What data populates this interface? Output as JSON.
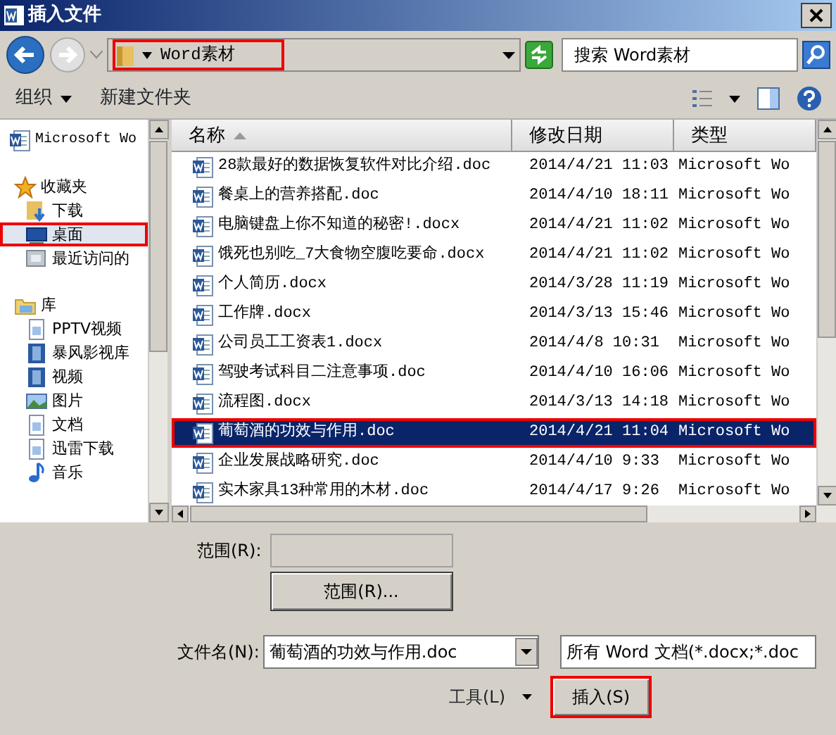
{
  "window": {
    "title": "插入文件"
  },
  "address": {
    "path": "Word素材",
    "highlighted": true
  },
  "search": {
    "placeholder": "搜索 Word素材"
  },
  "toolbar": [
    {
      "label": "组织",
      "menu": true
    },
    {
      "label": "新建文件夹",
      "menu": false
    }
  ],
  "sidebar": {
    "items": [
      {
        "label": "Microsoft Wo",
        "kind": "word",
        "selected": false,
        "highlighted": false
      },
      {
        "label": "收藏夹",
        "kind": "star",
        "selected": false,
        "highlighted": false,
        "children": [
          {
            "label": "下载",
            "kind": "download",
            "selected": false,
            "highlighted": false
          },
          {
            "label": "桌面",
            "kind": "desktop",
            "selected": true,
            "highlighted": true
          },
          {
            "label": "最近访问的",
            "kind": "recent",
            "selected": false,
            "highlighted": false
          }
        ]
      },
      {
        "label": "库",
        "kind": "library",
        "selected": false,
        "highlighted": false,
        "children": [
          {
            "label": "PPTV视频",
            "kind": "doc",
            "selected": false,
            "highlighted": false
          },
          {
            "label": "暴风影视库",
            "kind": "film",
            "selected": false,
            "highlighted": false
          },
          {
            "label": "视频",
            "kind": "film",
            "selected": false,
            "highlighted": false
          },
          {
            "label": "图片",
            "kind": "image",
            "selected": false,
            "highlighted": false
          },
          {
            "label": "文档",
            "kind": "doc",
            "selected": false,
            "highlighted": false
          },
          {
            "label": "迅雷下载",
            "kind": "doc",
            "selected": false,
            "highlighted": false
          },
          {
            "label": "音乐",
            "kind": "music",
            "selected": false,
            "highlighted": false
          }
        ]
      }
    ]
  },
  "table": {
    "columns": [
      {
        "label": "名称",
        "sorted": true
      },
      {
        "label": "修改日期",
        "sorted": false
      },
      {
        "label": "类型",
        "sorted": false
      }
    ],
    "rows": [
      {
        "name": "28款最好的数据恢复软件对比介绍.doc",
        "date": "2014/4/21 11:03",
        "type": "Microsoft Wo",
        "selected": false,
        "highlighted": false
      },
      {
        "name": "餐桌上的营养搭配.doc",
        "date": "2014/4/10 18:11",
        "type": "Microsoft Wo",
        "selected": false,
        "highlighted": false
      },
      {
        "name": "电脑键盘上你不知道的秘密!.docx",
        "date": "2014/4/21 11:02",
        "type": "Microsoft Wo",
        "selected": false,
        "highlighted": false
      },
      {
        "name": "饿死也别吃_7大食物空腹吃要命.docx",
        "date": "2014/4/21 11:02",
        "type": "Microsoft Wo",
        "selected": false,
        "highlighted": false
      },
      {
        "name": "个人简历.docx",
        "date": "2014/3/28 11:19",
        "type": "Microsoft Wo",
        "selected": false,
        "highlighted": false
      },
      {
        "name": "工作牌.docx",
        "date": "2014/3/13 15:46",
        "type": "Microsoft Wo",
        "selected": false,
        "highlighted": false
      },
      {
        "name": "公司员工工资表1.docx",
        "date": "2014/4/8 10:31",
        "type": "Microsoft Wo",
        "selected": false,
        "highlighted": false
      },
      {
        "name": "驾驶考试科目二注意事项.doc",
        "date": "2014/4/10 16:06",
        "type": "Microsoft Wo",
        "selected": false,
        "highlighted": false
      },
      {
        "name": "流程图.docx",
        "date": "2014/3/13 14:18",
        "type": "Microsoft Wo",
        "selected": false,
        "highlighted": false
      },
      {
        "name": "葡萄酒的功效与作用.doc",
        "date": "2014/4/21 11:04",
        "type": "Microsoft Wo",
        "selected": true,
        "highlighted": true
      },
      {
        "name": "企业发展战略研究.doc",
        "date": "2014/4/10 9:33",
        "type": "Microsoft Wo",
        "selected": false,
        "highlighted": false
      },
      {
        "name": "实木家具13种常用的木材.doc",
        "date": "2014/4/17 9:26",
        "type": "Microsoft Wo",
        "selected": false,
        "highlighted": false
      }
    ]
  },
  "range": {
    "label": "范围(R):",
    "disabled": true,
    "button": "范围(R)..."
  },
  "filename": {
    "label": "文件名(N):",
    "value": "葡萄酒的功效与作用.doc"
  },
  "filter": {
    "value": "所有 Word 文档(*.docx;*.doc"
  },
  "tools": {
    "label": "工具(L)"
  },
  "insert": {
    "label": "插入(S)",
    "highlighted": true
  }
}
